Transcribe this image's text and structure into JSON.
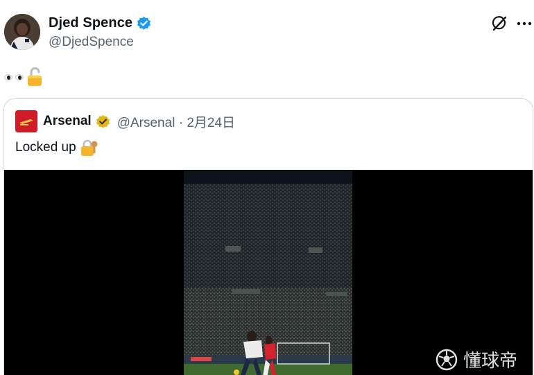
{
  "author": {
    "display_name": "Djed Spence",
    "handle": "@DjedSpence",
    "verified_color": "#1d9bf0"
  },
  "post": {
    "emojis": [
      "eyes-emoji",
      "unlocked-emoji"
    ]
  },
  "quote": {
    "display_name": "Arsenal",
    "handle": "@Arsenal",
    "separator": "·",
    "date": "2月24日",
    "text": "Locked up",
    "text_emoji": "locked-with-key-emoji",
    "verified_color": "#e2b719",
    "brand_color": "#d01c28"
  },
  "watermark": {
    "text": "懂球帝"
  },
  "icons": {
    "grok": "grok-icon",
    "more": "more-icon"
  }
}
